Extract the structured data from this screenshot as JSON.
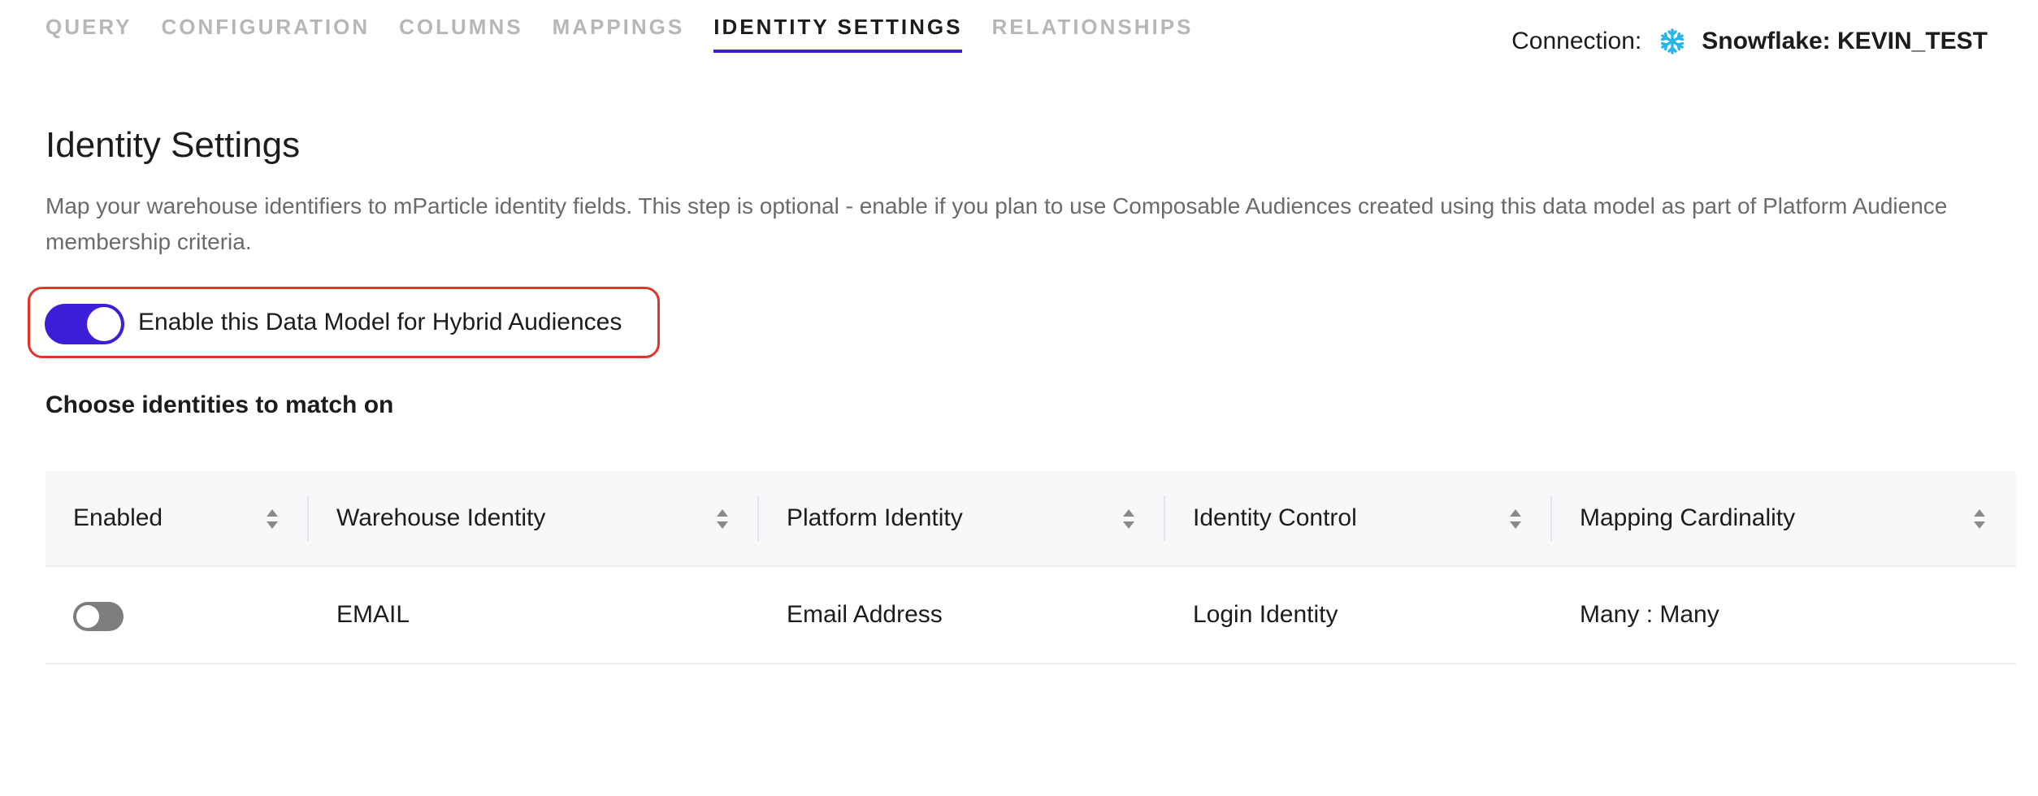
{
  "tabs": [
    {
      "label": "QUERY",
      "active": false
    },
    {
      "label": "CONFIGURATION",
      "active": false
    },
    {
      "label": "COLUMNS",
      "active": false
    },
    {
      "label": "MAPPINGS",
      "active": false
    },
    {
      "label": "IDENTITY SETTINGS",
      "active": true
    },
    {
      "label": "RELATIONSHIPS",
      "active": false
    }
  ],
  "connection": {
    "label": "Connection:",
    "icon": "snowflake-icon",
    "value": "Snowflake: KEVIN_TEST"
  },
  "page": {
    "title": "Identity Settings",
    "description": "Map your warehouse identifiers to mParticle identity fields. This step is optional - enable if you plan to use Composable Audiences created using this data model as part of Platform Audience membership criteria."
  },
  "hybrid_toggle": {
    "label": "Enable this Data Model for Hybrid Audiences",
    "enabled": true
  },
  "identities": {
    "title": "Choose identities to match on",
    "columns": [
      "Enabled",
      "Warehouse Identity",
      "Platform Identity",
      "Identity Control",
      "Mapping Cardinality"
    ],
    "rows": [
      {
        "enabled": false,
        "warehouse_identity": "EMAIL",
        "platform_identity": "Email Address",
        "identity_control": "Login Identity",
        "mapping_cardinality": "Many : Many"
      }
    ]
  },
  "colors": {
    "accent": "#3a1fd6",
    "highlight_border": "#e2342a",
    "snowflake": "#29b5e8"
  }
}
